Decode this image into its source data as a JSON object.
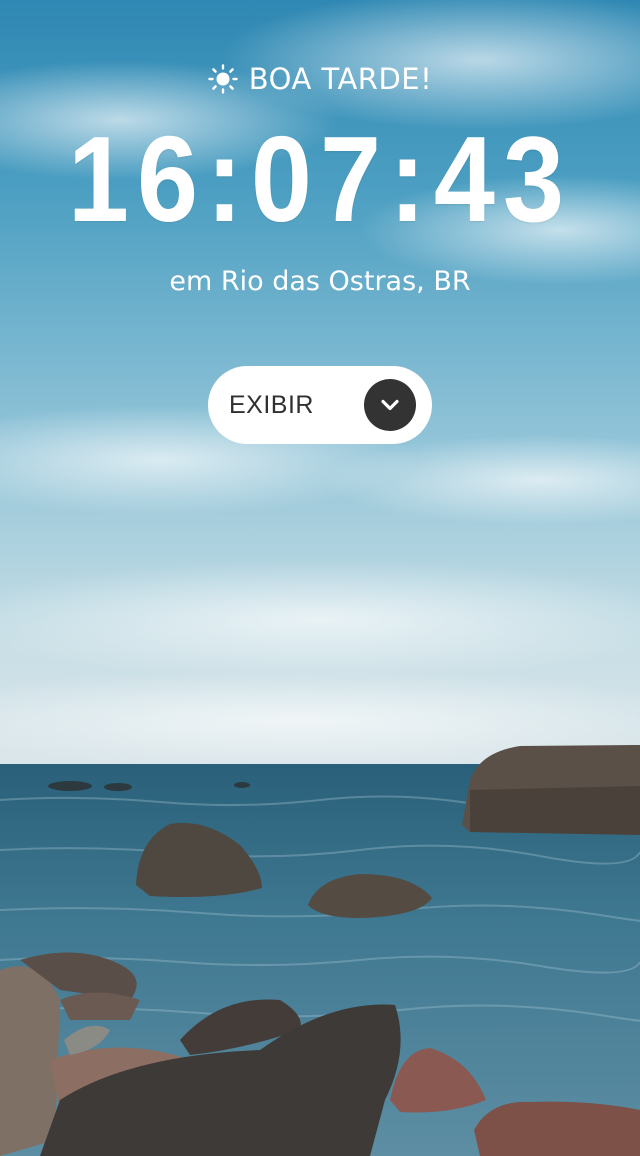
{
  "greeting": {
    "icon": "sun-icon",
    "text": "BOA TARDE!"
  },
  "clock": {
    "time": "16:07:43"
  },
  "location": {
    "text": "em Rio das Ostras, BR"
  },
  "toggle": {
    "label": "EXIBIR",
    "icon": "chevron-down-icon"
  },
  "background": {
    "description_icon": "seascape-photo",
    "sky_color": "#4e9cbc",
    "sea_color": "#2c5f78"
  }
}
